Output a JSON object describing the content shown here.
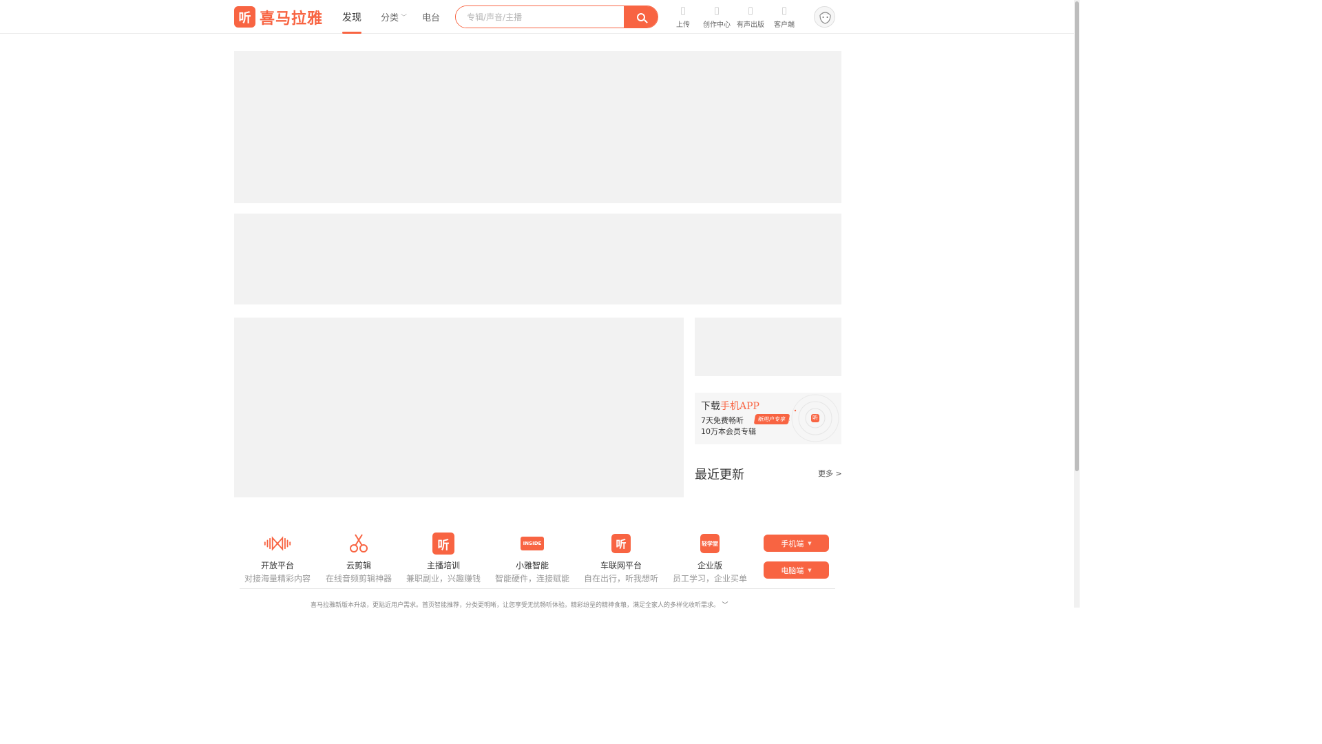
{
  "header": {
    "logo_text": "喜马拉雅",
    "logo_mark": "听",
    "nav": {
      "discover": "发现",
      "category": "分类",
      "radio": "电台"
    },
    "search_placeholder": "专辑/声音/主播",
    "tools": [
      {
        "label": "上传"
      },
      {
        "label": "创作中心"
      },
      {
        "label": "有声出版"
      },
      {
        "label": "客户端"
      }
    ]
  },
  "sidebar": {
    "app_promo": {
      "title_prefix": "下载",
      "title_highlight": "手机APP",
      "line1": "7天免费畅听",
      "badge": "新用户专享",
      "line2": "10万本会员专辑",
      "icon_mark": "听"
    },
    "recent_title": "最近更新",
    "recent_more": "更多 >"
  },
  "products": [
    {
      "name": "开放平台",
      "desc": "对接海量精彩内容",
      "icon": "waveform-icon"
    },
    {
      "name": "云剪辑",
      "desc": "在线音频剪辑神器",
      "icon": "scissors-icon"
    },
    {
      "name": "主播培训",
      "desc": "兼职副业，兴趣赚钱",
      "icon": "ting-mark-icon",
      "mark": "听"
    },
    {
      "name": "小雅智能",
      "desc": "智能硬件，连接赋能",
      "icon": "inside-chip-icon",
      "mark": "INSIDE"
    },
    {
      "name": "车联网平台",
      "desc": "自在出行，听我想听",
      "icon": "ting-car-icon",
      "mark": "听"
    },
    {
      "name": "企业版",
      "desc": "员工学习，企业买单",
      "icon": "qingxuetang-icon",
      "mark": "轻学堂"
    }
  ],
  "downloads": {
    "mobile": "手机端",
    "pc": "电脑端"
  },
  "notice": "喜马拉雅新版本升级，更贴近用户需求。首页智能推荐，分类更明晰，让您享受无忧畅听体验。精彩纷呈的精神食粮，满足全家人的多样化收听需求。",
  "colors": {
    "brand": "#f86442",
    "placeholder": "#f2f2f2"
  }
}
